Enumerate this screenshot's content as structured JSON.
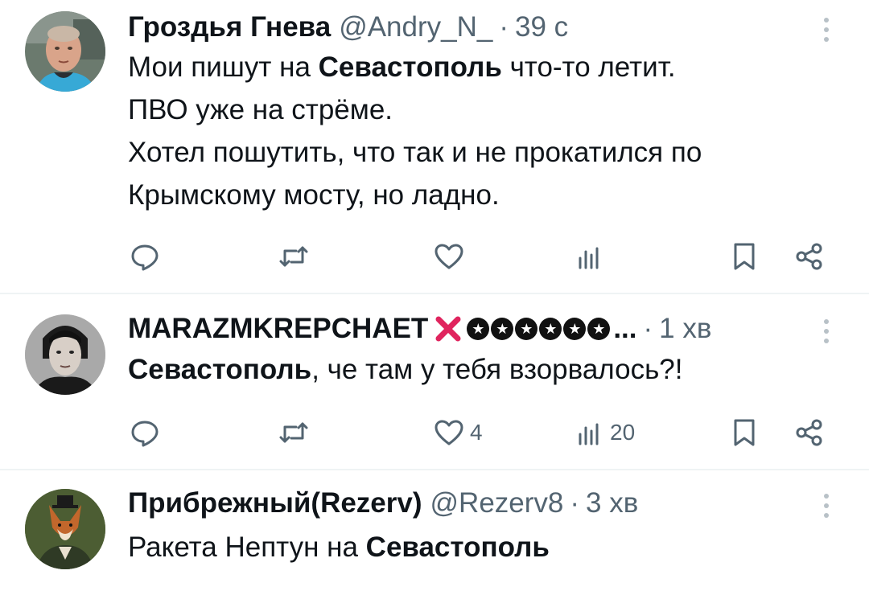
{
  "tweets": [
    {
      "name": "Гроздья Гнева",
      "handle": "@Andry_N_",
      "dot": "·",
      "time": "39 с",
      "lines": [
        {
          "pre": "Мои пишут на ",
          "bold": "Севастополь",
          "post": " что-то летит."
        },
        {
          "pre": "ПВО уже на стрёме.",
          "bold": "",
          "post": ""
        },
        {
          "pre": "Хотел пошутить, что так и не прокатился по",
          "bold": "",
          "post": ""
        },
        {
          "pre": "Крымскому мосту, но ладно.",
          "bold": "",
          "post": ""
        }
      ],
      "likes": "",
      "views": ""
    },
    {
      "name": "MARAZMKREPCHAET",
      "name_suffix": "...",
      "dot": "·",
      "time": "1 хв",
      "lines": [
        {
          "pre": "",
          "bold": "Севастополь",
          "post": ", че там у тебя взорвалось?!"
        }
      ],
      "likes": "4",
      "views": "20"
    },
    {
      "name": "Прибрежный(Rezerv)",
      "handle": "@Rezerv8",
      "dot": "·",
      "time": "3 хв",
      "lines": [
        {
          "pre": "Ракета Нептун на ",
          "bold": "Севастополь",
          "post": ""
        }
      ]
    }
  ],
  "icons": {
    "reply": "reply-icon",
    "retweet": "retweet-icon",
    "like": "heart-icon",
    "views": "views-icon",
    "bookmark": "bookmark-icon",
    "share": "share-icon",
    "more": "more-vertical-icon"
  },
  "colors": {
    "text": "#0f1419",
    "secondary": "#536471",
    "divider": "#eff3f4",
    "badge_red": "#e0245e"
  }
}
